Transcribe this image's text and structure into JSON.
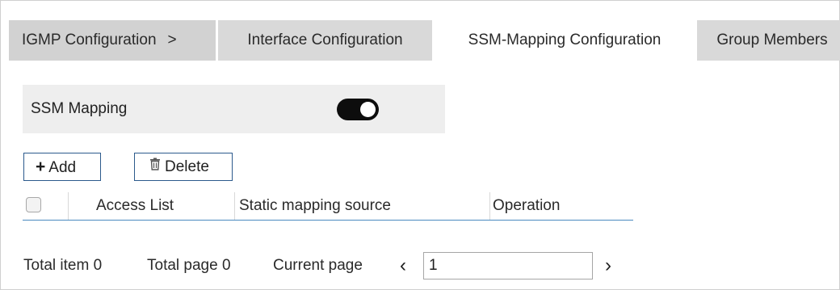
{
  "tabs": [
    {
      "label": "IGMP Configuration",
      "separator": ">",
      "active": false
    },
    {
      "label": "Interface Configuration",
      "active": false
    },
    {
      "label": "SSM-Mapping Configuration",
      "active": true
    },
    {
      "label": "Group Members",
      "active": false
    }
  ],
  "ssm_mapping": {
    "label": "SSM Mapping",
    "enabled": true
  },
  "toolbar": {
    "add_icon": "plus-icon",
    "add_label": "Add",
    "delete_icon": "trash-icon",
    "delete_label": "Delete"
  },
  "table": {
    "columns": [
      "Access List",
      "Static mapping source",
      "Operation"
    ],
    "rows": []
  },
  "pagination": {
    "total_item": "Total item 0",
    "total_page": "Total page 0",
    "current_page_label": "Current page",
    "current_page_value": "1",
    "prev_icon": "chevron-left-icon",
    "next_icon": "chevron-right-icon"
  },
  "colors": {
    "tab_inactive": "#d9d9d9",
    "toggle_on": "#0d0d0d",
    "button_border": "#2c5a8c",
    "table_header_border": "#4a8ac0"
  }
}
